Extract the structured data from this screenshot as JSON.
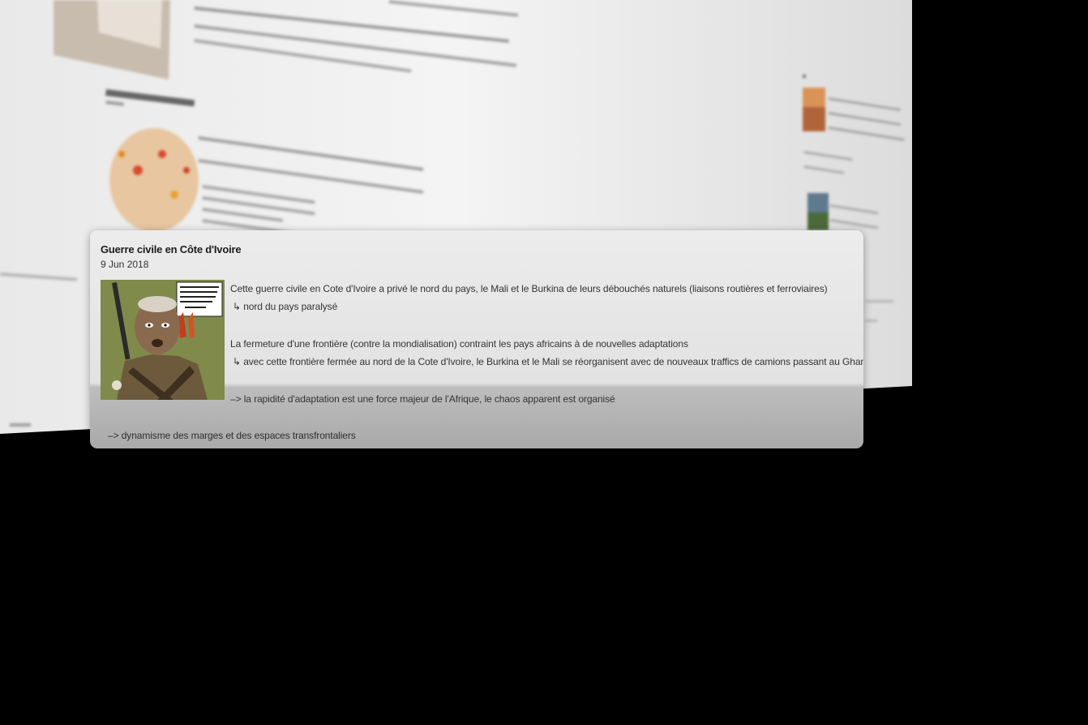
{
  "card": {
    "title": "Guerre civile en Côte d'Ivoire",
    "date": "9 Jun 2018",
    "image_label": "caricature-soldier",
    "image_caption": "C'EST PAS UNE GUERRE SI VITE QUE ÇA... JE TIRE JUSTE SUR MON PEUPLE, COMME KADHAFI ET ASSAD !",
    "paragraph_1": "Cette guerre civile en Cote d'Ivoire a privé le nord du pays, le Mali et le Burkina de leurs débouchés naturels (liaisons routières et ferroviaires)",
    "sub_1": "↳ nord du pays paralysé",
    "paragraph_2": "La fermeture d'une frontière (contre la mondialisation) contraint les pays africains à de nouvelles adaptations",
    "sub_2": "↳ avec cette frontière fermée au nord de la Cote d'Ivoire, le Burkina et le Mali se réorganisent avec de nouveaux traffics de camions passant au Ghana",
    "paragraph_3": "–> la rapidité d'adaptation est une force majeur de l'Afrique, le chaos apparent est organisé",
    "paragraph_4": "–> dynamisme des marges et des espaces transfrontaliers"
  },
  "background": {
    "section_heading": "Zone d'instabilité en Afrique"
  },
  "colors": {
    "page_bg": "#000000",
    "doc_bg": "#f2f2f2",
    "card_bg": "#e8e8e8"
  }
}
